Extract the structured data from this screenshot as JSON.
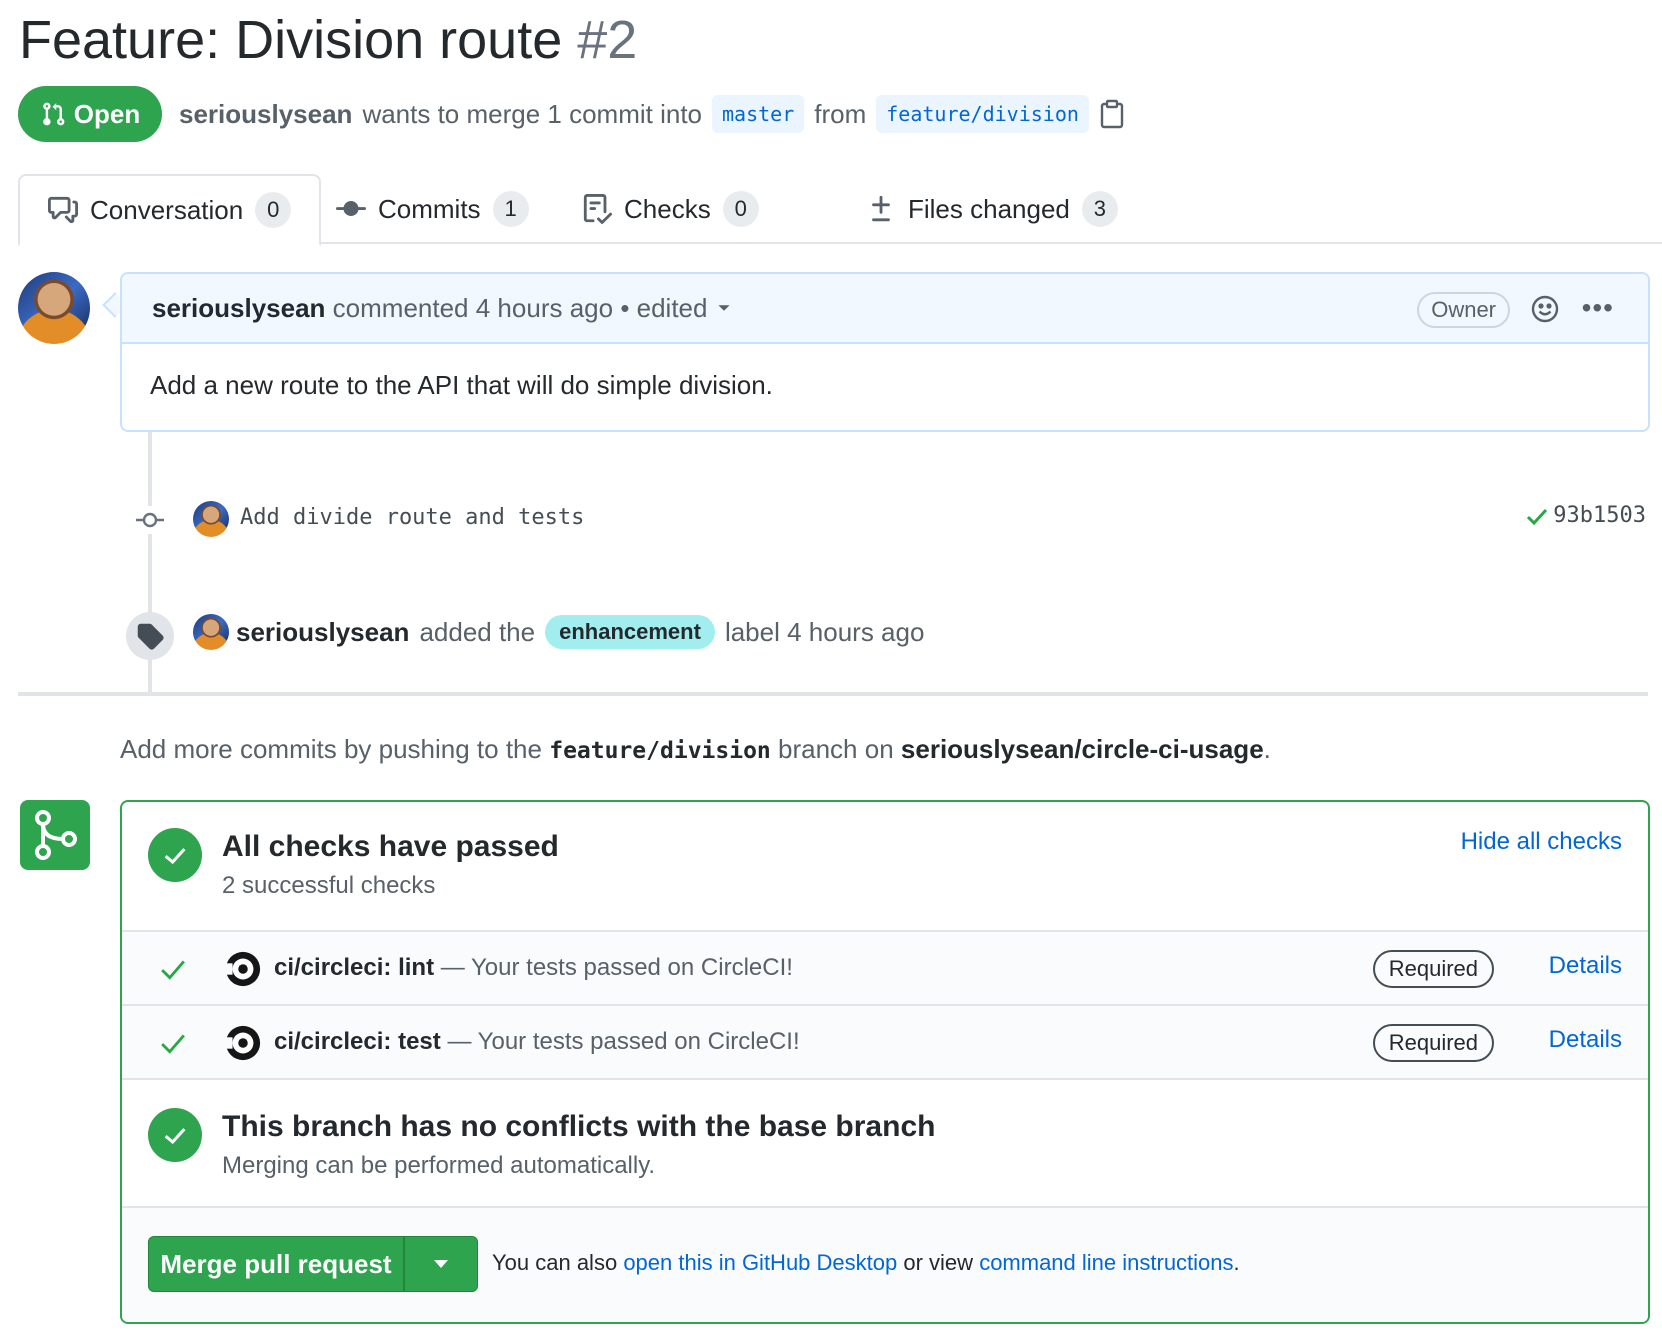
{
  "pr": {
    "title": "Feature: Division route",
    "number": "#2",
    "state": "Open",
    "author": "seriouslysean",
    "merge_text": "wants to merge 1 commit into",
    "base_branch": "master",
    "from_text": "from",
    "head_branch": "feature/division"
  },
  "tabs": [
    {
      "label": "Conversation",
      "count": "0",
      "icon": "comment-discussion-icon"
    },
    {
      "label": "Commits",
      "count": "1",
      "icon": "git-commit-icon"
    },
    {
      "label": "Checks",
      "count": "0",
      "icon": "checklist-icon"
    },
    {
      "label": "Files changed",
      "count": "3",
      "icon": "diff-icon"
    }
  ],
  "comment": {
    "author": "seriouslysean",
    "action": "commented",
    "time": "4 hours ago",
    "edited": "• edited",
    "role": "Owner",
    "body": "Add a new route to the API that will do simple division."
  },
  "commit_event": {
    "message": "Add divide route and tests",
    "sha": "93b1503",
    "status_color": "#28a745"
  },
  "label_event": {
    "actor": "seriouslysean",
    "action": "added the",
    "label": "enhancement",
    "label_color": "#a2eeef",
    "suffix": "label 4 hours ago"
  },
  "push_hint": {
    "prefix": "Add more commits by pushing to the",
    "branch": "feature/division",
    "middle": "branch on",
    "repo": "seriouslysean/circle-ci-usage",
    "suffix": "."
  },
  "checks": {
    "title": "All checks have passed",
    "subtitle": "2 successful checks",
    "hide_label": "Hide all checks",
    "items": [
      {
        "name": "ci/circleci: lint",
        "description": "— Your tests passed on CircleCI!",
        "badge": "Required",
        "details": "Details"
      },
      {
        "name": "ci/circleci: test",
        "description": "— Your tests passed on CircleCI!",
        "badge": "Required",
        "details": "Details"
      }
    ]
  },
  "conflicts": {
    "title": "This branch has no conflicts with the base branch",
    "subtitle": "Merging can be performed automatically."
  },
  "merge": {
    "button": "Merge pull request",
    "alt_prefix": "You can also",
    "alt_link1": "open this in GitHub Desktop",
    "alt_middle": "or view",
    "alt_link2": "command line instructions",
    "alt_suffix": "."
  },
  "colors": {
    "success": "#2ea44f",
    "link": "#0366d6",
    "comment_header_bg": "#f1f8ff"
  }
}
